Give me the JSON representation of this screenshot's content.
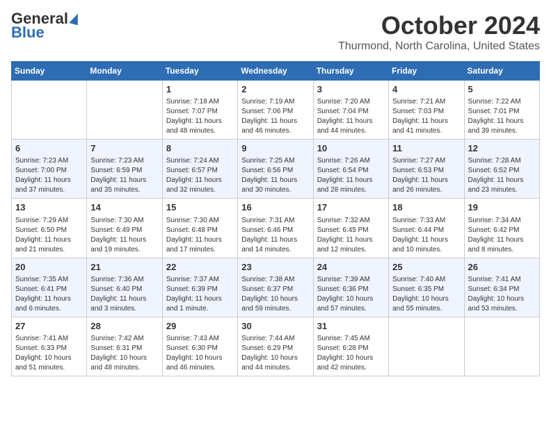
{
  "logo": {
    "line1": "General",
    "line2": "Blue"
  },
  "title": "October 2024",
  "subtitle": "Thurmond, North Carolina, United States",
  "days_of_week": [
    "Sunday",
    "Monday",
    "Tuesday",
    "Wednesday",
    "Thursday",
    "Friday",
    "Saturday"
  ],
  "weeks": [
    [
      {
        "day": "",
        "info": ""
      },
      {
        "day": "",
        "info": ""
      },
      {
        "day": "1",
        "info": "Sunrise: 7:18 AM\nSunset: 7:07 PM\nDaylight: 11 hours and 48 minutes."
      },
      {
        "day": "2",
        "info": "Sunrise: 7:19 AM\nSunset: 7:06 PM\nDaylight: 11 hours and 46 minutes."
      },
      {
        "day": "3",
        "info": "Sunrise: 7:20 AM\nSunset: 7:04 PM\nDaylight: 11 hours and 44 minutes."
      },
      {
        "day": "4",
        "info": "Sunrise: 7:21 AM\nSunset: 7:03 PM\nDaylight: 11 hours and 41 minutes."
      },
      {
        "day": "5",
        "info": "Sunrise: 7:22 AM\nSunset: 7:01 PM\nDaylight: 11 hours and 39 minutes."
      }
    ],
    [
      {
        "day": "6",
        "info": "Sunrise: 7:23 AM\nSunset: 7:00 PM\nDaylight: 11 hours and 37 minutes."
      },
      {
        "day": "7",
        "info": "Sunrise: 7:23 AM\nSunset: 6:59 PM\nDaylight: 11 hours and 35 minutes."
      },
      {
        "day": "8",
        "info": "Sunrise: 7:24 AM\nSunset: 6:57 PM\nDaylight: 11 hours and 32 minutes."
      },
      {
        "day": "9",
        "info": "Sunrise: 7:25 AM\nSunset: 6:56 PM\nDaylight: 11 hours and 30 minutes."
      },
      {
        "day": "10",
        "info": "Sunrise: 7:26 AM\nSunset: 6:54 PM\nDaylight: 11 hours and 28 minutes."
      },
      {
        "day": "11",
        "info": "Sunrise: 7:27 AM\nSunset: 6:53 PM\nDaylight: 11 hours and 26 minutes."
      },
      {
        "day": "12",
        "info": "Sunrise: 7:28 AM\nSunset: 6:52 PM\nDaylight: 11 hours and 23 minutes."
      }
    ],
    [
      {
        "day": "13",
        "info": "Sunrise: 7:29 AM\nSunset: 6:50 PM\nDaylight: 11 hours and 21 minutes."
      },
      {
        "day": "14",
        "info": "Sunrise: 7:30 AM\nSunset: 6:49 PM\nDaylight: 11 hours and 19 minutes."
      },
      {
        "day": "15",
        "info": "Sunrise: 7:30 AM\nSunset: 6:48 PM\nDaylight: 11 hours and 17 minutes."
      },
      {
        "day": "16",
        "info": "Sunrise: 7:31 AM\nSunset: 6:46 PM\nDaylight: 11 hours and 14 minutes."
      },
      {
        "day": "17",
        "info": "Sunrise: 7:32 AM\nSunset: 6:45 PM\nDaylight: 11 hours and 12 minutes."
      },
      {
        "day": "18",
        "info": "Sunrise: 7:33 AM\nSunset: 6:44 PM\nDaylight: 11 hours and 10 minutes."
      },
      {
        "day": "19",
        "info": "Sunrise: 7:34 AM\nSunset: 6:42 PM\nDaylight: 11 hours and 8 minutes."
      }
    ],
    [
      {
        "day": "20",
        "info": "Sunrise: 7:35 AM\nSunset: 6:41 PM\nDaylight: 11 hours and 6 minutes."
      },
      {
        "day": "21",
        "info": "Sunrise: 7:36 AM\nSunset: 6:40 PM\nDaylight: 11 hours and 3 minutes."
      },
      {
        "day": "22",
        "info": "Sunrise: 7:37 AM\nSunset: 6:39 PM\nDaylight: 11 hours and 1 minute."
      },
      {
        "day": "23",
        "info": "Sunrise: 7:38 AM\nSunset: 6:37 PM\nDaylight: 10 hours and 59 minutes."
      },
      {
        "day": "24",
        "info": "Sunrise: 7:39 AM\nSunset: 6:36 PM\nDaylight: 10 hours and 57 minutes."
      },
      {
        "day": "25",
        "info": "Sunrise: 7:40 AM\nSunset: 6:35 PM\nDaylight: 10 hours and 55 minutes."
      },
      {
        "day": "26",
        "info": "Sunrise: 7:41 AM\nSunset: 6:34 PM\nDaylight: 10 hours and 53 minutes."
      }
    ],
    [
      {
        "day": "27",
        "info": "Sunrise: 7:41 AM\nSunset: 6:33 PM\nDaylight: 10 hours and 51 minutes."
      },
      {
        "day": "28",
        "info": "Sunrise: 7:42 AM\nSunset: 6:31 PM\nDaylight: 10 hours and 48 minutes."
      },
      {
        "day": "29",
        "info": "Sunrise: 7:43 AM\nSunset: 6:30 PM\nDaylight: 10 hours and 46 minutes."
      },
      {
        "day": "30",
        "info": "Sunrise: 7:44 AM\nSunset: 6:29 PM\nDaylight: 10 hours and 44 minutes."
      },
      {
        "day": "31",
        "info": "Sunrise: 7:45 AM\nSunset: 6:28 PM\nDaylight: 10 hours and 42 minutes."
      },
      {
        "day": "",
        "info": ""
      },
      {
        "day": "",
        "info": ""
      }
    ]
  ]
}
